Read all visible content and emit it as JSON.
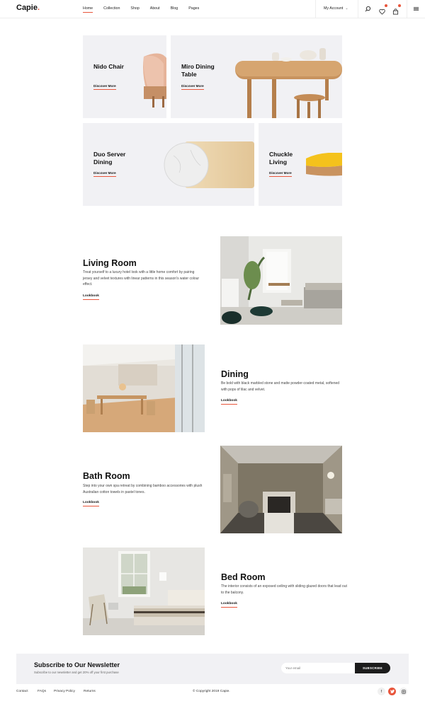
{
  "header": {
    "logo": "Capie",
    "logo_dot": ".",
    "nav": [
      "Home",
      "Collection",
      "Shop",
      "About",
      "Blog",
      "Pages"
    ],
    "account_label": "My Account",
    "icons": [
      "search-icon",
      "heart-icon",
      "cart-icon",
      "menu-icon"
    ]
  },
  "products": [
    {
      "title": "Nido Chair",
      "link": "Discover More"
    },
    {
      "title": "Miro Dining Table",
      "link": "Discover More"
    },
    {
      "title": "Duo Server Dining",
      "link": "Discover More"
    },
    {
      "title": "Chuckle Living",
      "link": "Discover More"
    }
  ],
  "sections": [
    {
      "title": "Living Room",
      "text": "Treat yourself to a luxury hotel look with a little home comfort by pairing jersey and velvet textures with linear patterns in this season's water colour effect.",
      "link": "Lookbook"
    },
    {
      "title": "Dining",
      "text": "Be bold with black marbled stone and matte powder-coated metal, softened with pops of lilac and velvet.",
      "link": "Lookbook"
    },
    {
      "title": "Bath Room",
      "text": "Step into your own spa retreat by combining bamboo accessories with plush Australian cotton towels in pastel tones.",
      "link": "Lookbook"
    },
    {
      "title": "Bed Room",
      "text": "The interior consists of an exposed ceiling with sliding glazed doors that lead out to the balcony.",
      "link": "Lookbook"
    }
  ],
  "newsletter": {
    "title": "Subscribe to Our Newsletter",
    "subtitle": "Subscribe to our newsletter and get 20% off your first purchase",
    "placeholder": "Your email",
    "button": "SUBSCRIBE"
  },
  "footer": {
    "links": [
      "Contact",
      "FAQs",
      "Privacy Policy",
      "Returns"
    ],
    "copyright": "© Copyright 2019 Capie.",
    "social": [
      "facebook-icon",
      "twitter-icon",
      "instagram-icon"
    ]
  },
  "colors": {
    "accent": "#e8553b",
    "card_bg": "#f1f1f4",
    "dark": "#1c1c1c"
  }
}
